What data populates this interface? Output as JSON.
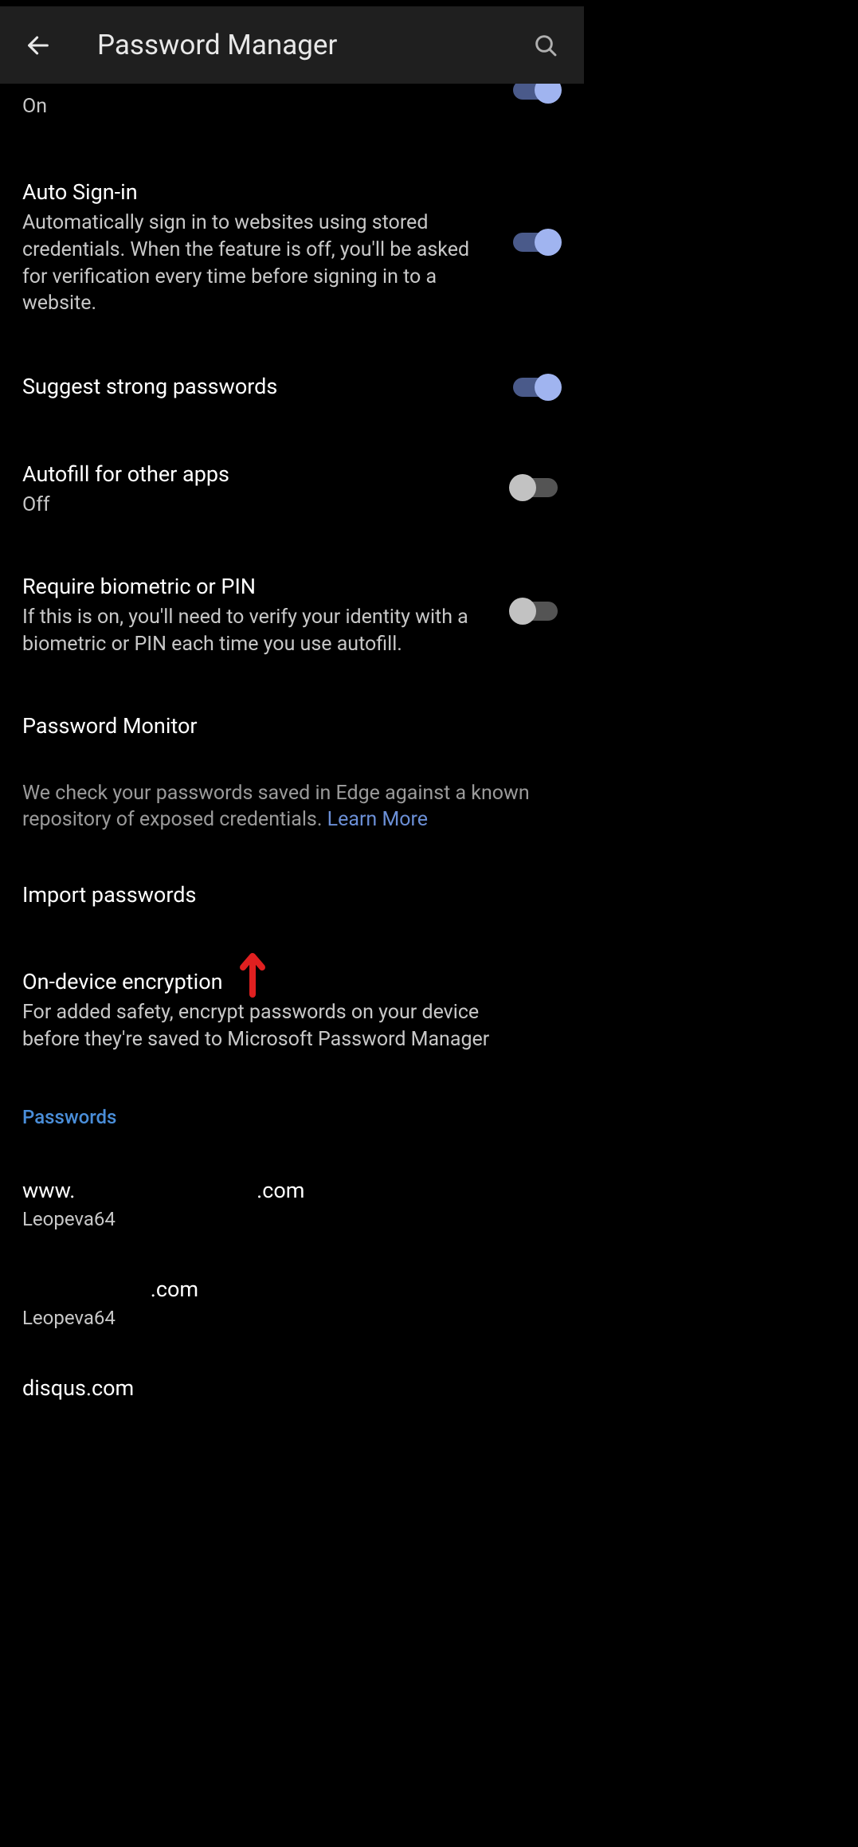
{
  "header": {
    "title": "Password Manager"
  },
  "settings": {
    "save_passwords": {
      "subtitle": "On",
      "on": true
    },
    "auto_signin": {
      "title": "Auto Sign-in",
      "subtitle": "Automatically sign in to websites using stored credentials. When the feature is off, you'll be asked for verification every time before signing in to a website.",
      "on": true
    },
    "suggest_strong": {
      "title": "Suggest strong passwords",
      "on": true
    },
    "autofill_other": {
      "title": "Autofill for other apps",
      "subtitle": "Off",
      "on": false
    },
    "require_biometric": {
      "title": "Require biometric or PIN",
      "subtitle": "If this is on, you'll need to verify your identity with a biometric or PIN each time you use autofill.",
      "on": false
    },
    "password_monitor": {
      "title": "Password Monitor",
      "desc_pre": "We check your passwords saved in Edge against a known repository of exposed credentials. ",
      "learn_more": "Learn More"
    },
    "import_passwords": {
      "title": "Import passwords"
    },
    "on_device_encryption": {
      "title": "On-device encryption",
      "subtitle": "For added safety, encrypt passwords on your device before they're saved to Microsoft Password Manager"
    }
  },
  "passwords_section": {
    "label": "Passwords",
    "entries": [
      {
        "site_pre": "www.",
        "site_post": ".com",
        "user": "Leopeva64"
      },
      {
        "site_pre": "",
        "site_post": ".com",
        "user": "Leopeva64"
      },
      {
        "site_pre": "disqus.com",
        "site_post": "",
        "user": ""
      }
    ]
  }
}
